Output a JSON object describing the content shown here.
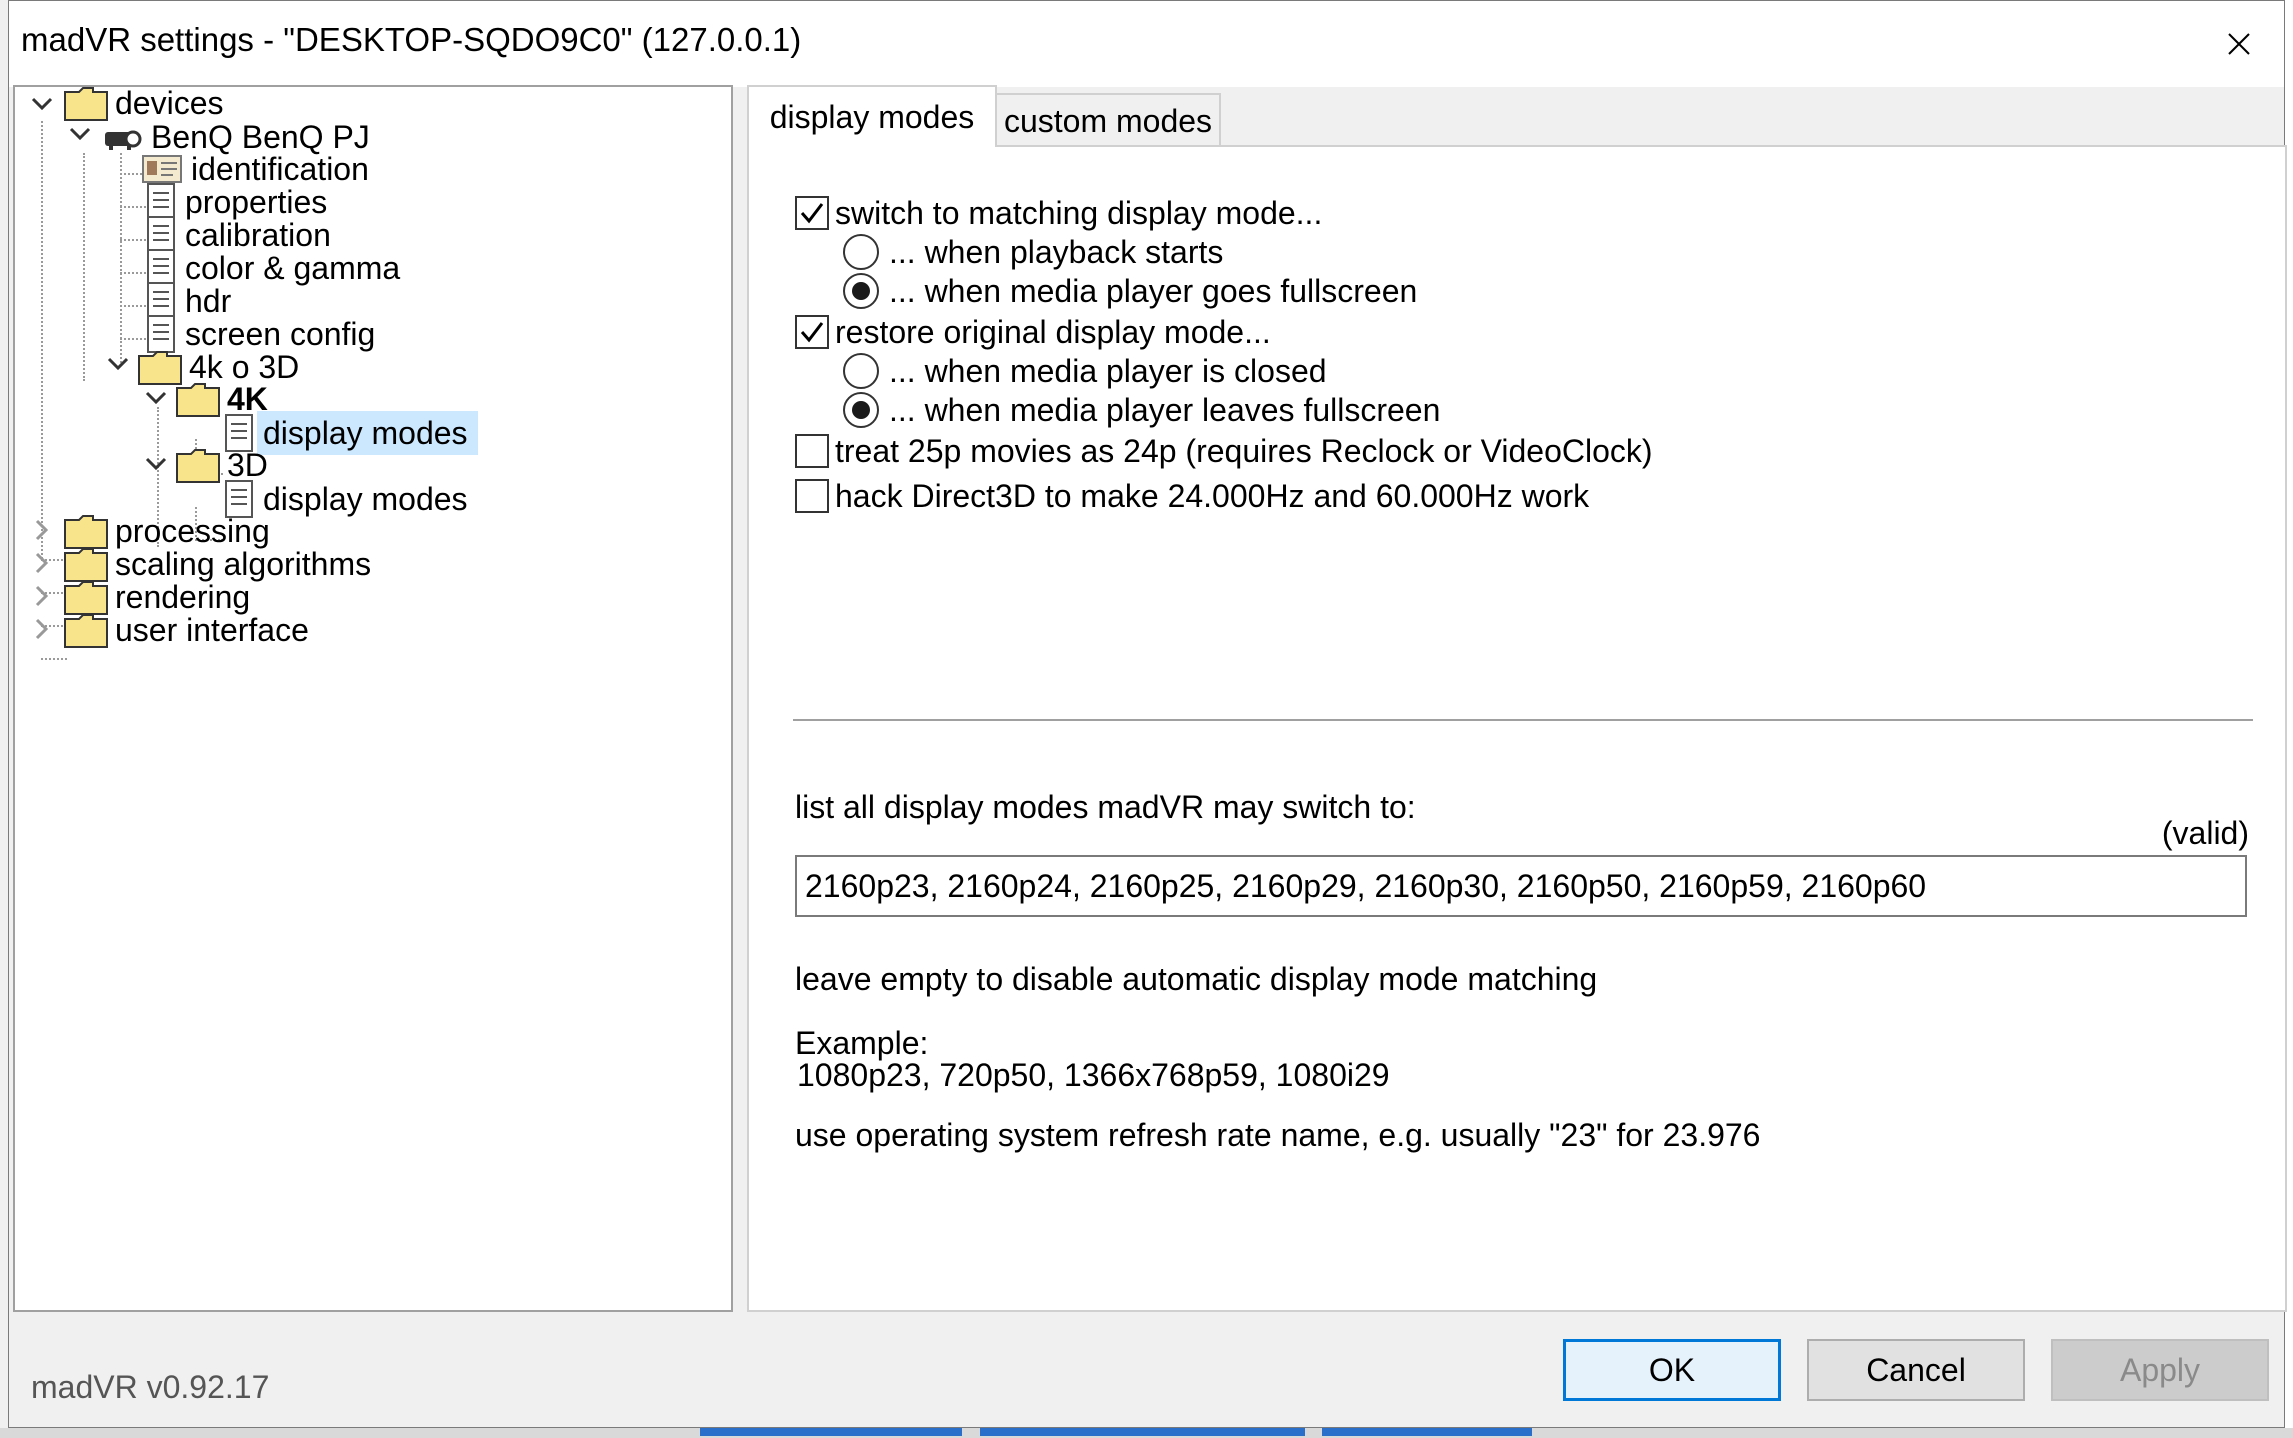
{
  "window": {
    "title": "madVR settings - \"DESKTOP-SQDO9C0\" (127.0.0.1)"
  },
  "tree": {
    "devices": "devices",
    "device": "BenQ BenQ PJ",
    "identification": "identification",
    "properties": "properties",
    "calibration": "calibration",
    "color_gamma": "color & gamma",
    "hdr": "hdr",
    "screen_config": "screen config",
    "group": "4k o 3D",
    "group_4k": "4K",
    "display_modes_4k": "display modes",
    "group_3d": "3D",
    "display_modes_3d": "display modes",
    "processing": "processing",
    "scaling_algorithms": "scaling algorithms",
    "rendering": "rendering",
    "user_interface": "user interface"
  },
  "tabs": {
    "display_modes": "display modes",
    "custom_modes": "custom modes"
  },
  "options": {
    "switch_matching": {
      "label": "switch to matching display mode...",
      "checked": true
    },
    "when_playback_starts": {
      "label": "... when playback starts",
      "selected": false
    },
    "when_fullscreen": {
      "label": "... when media player goes fullscreen",
      "selected": true
    },
    "restore_original": {
      "label": "restore original display mode...",
      "checked": true
    },
    "when_closed": {
      "label": "... when media player is closed",
      "selected": false
    },
    "when_leaves_fullscreen": {
      "label": "... when media player leaves fullscreen",
      "selected": true
    },
    "treat_25p": {
      "label": "treat 25p movies as 24p  (requires Reclock or VideoClock)",
      "checked": false
    },
    "hack_d3d": {
      "label": "hack Direct3D to make 24.000Hz and 60.000Hz work",
      "checked": false
    }
  },
  "modes_list": {
    "label": "list all display modes madVR may switch to:",
    "status": "(valid)",
    "value": "2160p23, 2160p24, 2160p25, 2160p29, 2160p30, 2160p50, 2160p59, 2160p60"
  },
  "help": {
    "leave_empty": "leave empty to disable automatic display mode matching",
    "example_label": "Example:",
    "example_value": "1080p23, 720p50, 1366x768p59, 1080i29",
    "refresh_note": "use operating system refresh rate name, e.g. usually \"23\" for 23.976"
  },
  "footer": {
    "version": "madVR v0.92.17",
    "ok": "OK",
    "cancel": "Cancel",
    "apply": "Apply"
  },
  "colors": {
    "selection": "#cce8ff",
    "ok_border": "#0078d7",
    "folder": "#f8e48a"
  }
}
